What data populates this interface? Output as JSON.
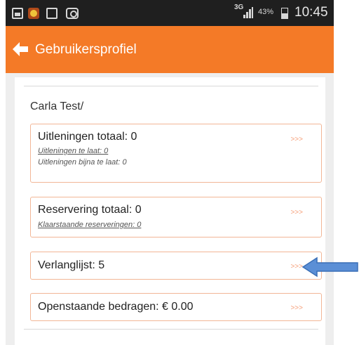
{
  "status_bar": {
    "network": "3G",
    "battery": "43%",
    "time": "10:45",
    "icons": [
      "gallery-icon",
      "app-icon",
      "screenshot-icon",
      "camera-icon",
      "signal-icon",
      "battery-icon"
    ]
  },
  "header": {
    "back_icon": "arrow-left-icon",
    "title": "Gebruikersprofiel",
    "color": "#f47a27"
  },
  "profile": {
    "name": "Carla Test/"
  },
  "sections": {
    "loans": {
      "main": "Uitleningen totaal: 0",
      "late": "Uitleningen te laat: 0",
      "almost_late": "Uitleningen bijna te laat: 0",
      "arrow": ">>>"
    },
    "reservations": {
      "main": "Reservering totaal: 0",
      "ready": "Klaarstaande reserveringen: 0",
      "arrow": ">>>"
    },
    "wishlist": {
      "main": "Verlanglijst: 5",
      "arrow": ">>>"
    },
    "outstanding": {
      "main": "Openstaande bedragen: € 0.00",
      "arrow": ">>>"
    }
  },
  "annotation": {
    "pointer_color": "#5b8fd6"
  }
}
